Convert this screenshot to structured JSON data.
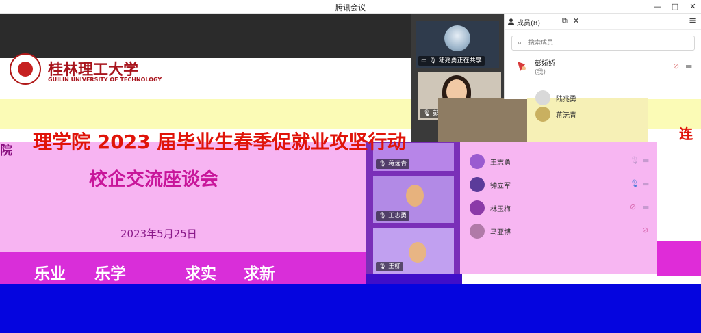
{
  "window": {
    "title": "腾讯会议",
    "minimize": "—",
    "maximize": "□",
    "close": "✕"
  },
  "slide": {
    "university_cn": "桂林理工大学",
    "university_en": "GUILIN UNIVERSITY OF TECHNOLOGY",
    "headline_left": "院",
    "headline": "理学院 2023 届毕业生春季促就业攻坚行动",
    "subtitle": "校企交流座谈会",
    "date": "2023年5月25日",
    "motto": [
      "乐业",
      "乐学",
      "求实",
      "求新"
    ],
    "right_glyph": "连"
  },
  "sharing_status": "陆兆勇正在共享",
  "video_tiles": [
    {
      "name": "彭娇娇"
    },
    {
      "name": "蒋远青"
    },
    {
      "name": "王志勇"
    },
    {
      "name": "王柳"
    }
  ],
  "panel": {
    "title": "成员(8)",
    "search_placeholder": "搜索成员",
    "me": {
      "name": "彭娇娇",
      "sub": "(我)"
    },
    "members": [
      {
        "name": "陆兆勇"
      },
      {
        "name": "蒋沅青"
      },
      {
        "name": "王志勇"
      },
      {
        "name": "钟立军"
      },
      {
        "name": "林玉梅"
      },
      {
        "name": "马亚博"
      }
    ]
  },
  "icons": {
    "members": "person-icon",
    "popout": "popout-icon",
    "close": "close-icon",
    "menu": "menu-icon",
    "search": "search-icon",
    "mic": "mic-icon",
    "mic_muted": "mic-muted-icon",
    "camera": "camera-icon"
  },
  "colors": {
    "accent_red": "#e0140a",
    "slide_pink": "#f7b4f2",
    "band_magenta": "#d92ed9",
    "band_blue": "#0505df"
  }
}
